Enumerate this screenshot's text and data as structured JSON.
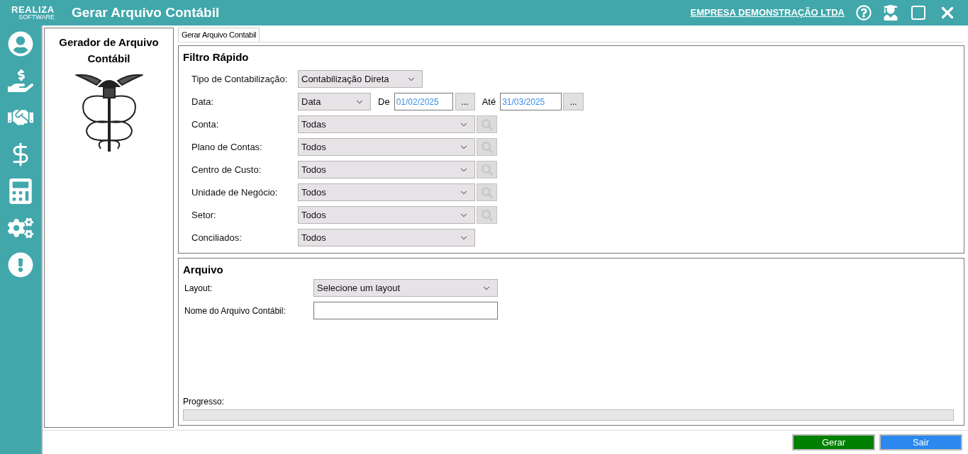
{
  "window": {
    "logo_top": "REALIZA",
    "logo_bottom": "SOFTWARE",
    "title": "Gerar Arquivo Contábil",
    "company": "EMPRESA DEMONSTRAÇÃO LTDA"
  },
  "sidebar": {
    "items": [
      {
        "kind": "user"
      },
      {
        "kind": "payment"
      },
      {
        "kind": "deal"
      },
      {
        "kind": "money"
      },
      {
        "kind": "calculator"
      },
      {
        "kind": "settings"
      },
      {
        "kind": "alert"
      }
    ]
  },
  "left_panel": {
    "title": "Gerador de Arquivo Contábil"
  },
  "tabs": [
    {
      "label": "Gerar Arquivo Contabil",
      "selected": true
    }
  ],
  "filter": {
    "title": "Filtro Rápido",
    "rows": [
      {
        "kind": "short_select",
        "label": "Tipo de Contabilização:",
        "value": "Contabilização Direta"
      },
      {
        "kind": "date",
        "label": "Data:",
        "value": "Data",
        "from_label": "De",
        "from_value": "01/02/2025",
        "from_button": "...",
        "to_label": "Até",
        "to_value": "31/03/2025",
        "to_button": "..."
      },
      {
        "kind": "lookup",
        "label": "Conta:",
        "value": "Todas"
      },
      {
        "kind": "lookup",
        "label": "Plano de Contas:",
        "value": "Todos"
      },
      {
        "kind": "lookup",
        "label": "Centro de Custo:",
        "value": "Todos"
      },
      {
        "kind": "lookup",
        "label": "Unidade de Negócio:",
        "value": "Todos"
      },
      {
        "kind": "lookup",
        "label": "Setor:",
        "value": "Todos"
      },
      {
        "kind": "select",
        "label": "Conciliados:",
        "value": "Todos"
      }
    ]
  },
  "file": {
    "title": "Arquivo",
    "layout_label": "Layout:",
    "layout_value": "Selecione um layout",
    "name_label": "Nome do Arquivo Contábil:",
    "progress_label": "Progresso:",
    "progress": {
      "level": 0
    }
  },
  "buttons": [
    {
      "kind": "primary",
      "label": "Gerar"
    },
    {
      "kind": "secondary",
      "label": "Sair"
    }
  ]
}
